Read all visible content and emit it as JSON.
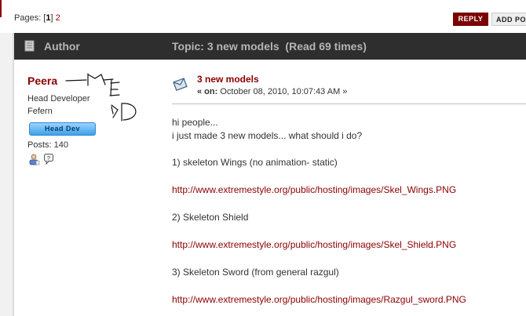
{
  "pagination": {
    "label": "Pages:",
    "current": "1",
    "next": "2"
  },
  "buttons": {
    "reply": "REPLY",
    "add_poll": "ADD PO"
  },
  "header": {
    "author_label": "Author",
    "topic_title": "Topic: 3 new models  (Read 69 times)"
  },
  "poster": {
    "name": "Peera",
    "title": "Head Developer",
    "location": "Fefern",
    "badge": "Head Dev",
    "posts": "Posts: 140"
  },
  "post": {
    "subject": "3 new models",
    "date_prefix": "« on:",
    "date": "October 08, 2010, 10:07:43 AM »",
    "lines": [
      "hi people...",
      "i just made 3 new models... what should i do?",
      "1) skeleton Wings (no animation- static)",
      "http://www.extremestyle.org/public/hosting/images/Skel_Wings.PNG",
      "2) Skeleton Shield",
      "http://www.extremestyle.org/public/hosting/images/Skel_Shield.PNG",
      "3) Skeleton Sword (from general razgul)",
      "http://www.extremestyle.org/public/hosting/images/Razgul_sword.PNG"
    ]
  },
  "colors": {
    "accent": "#8b0000",
    "header_bg": "#2e2e2e",
    "badge_blue": "#3ba2ea"
  }
}
